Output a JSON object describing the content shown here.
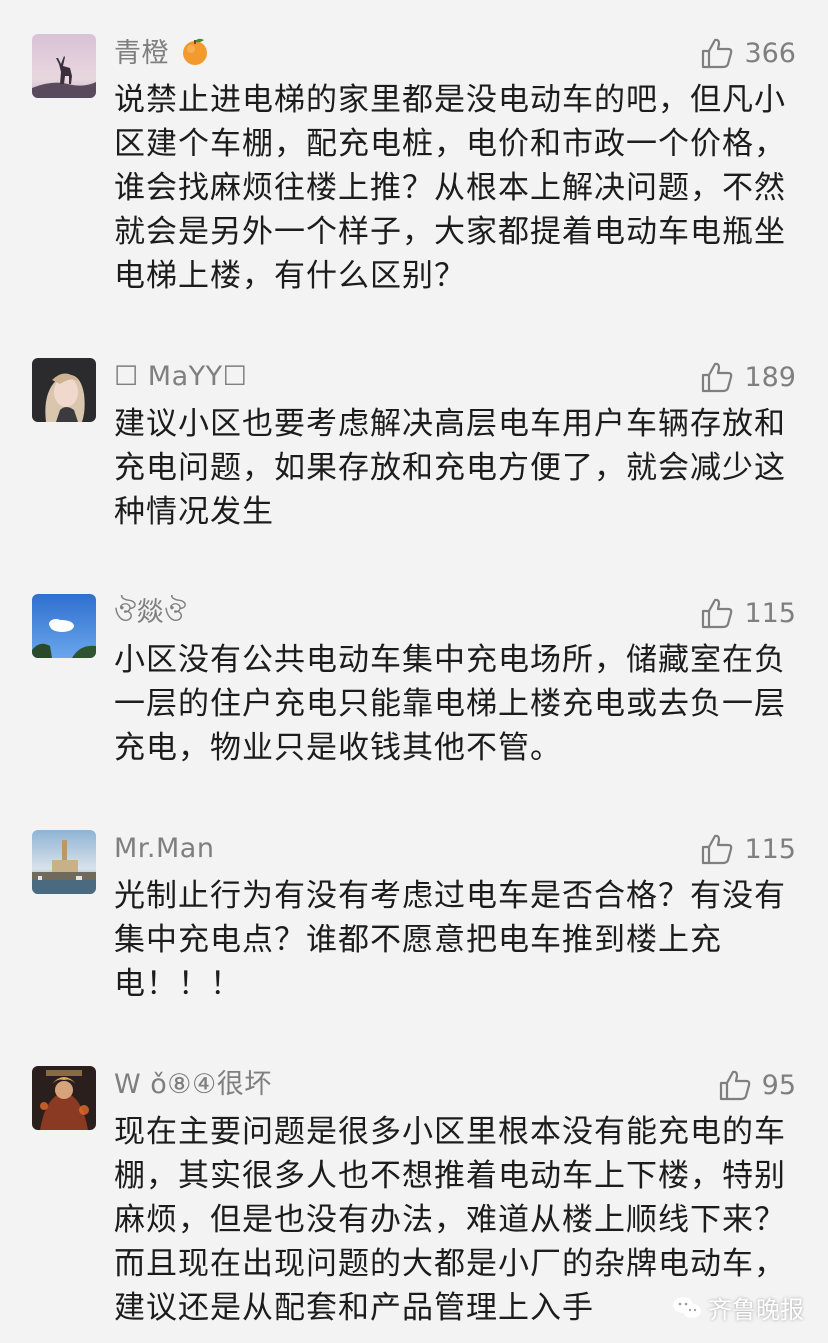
{
  "comments": [
    {
      "username": "青橙",
      "likes": "366",
      "text": "说禁止进电梯的家里都是没电动车的吧，但凡小区建个车棚，配充电桩，电价和市政一个价格，谁会找麻烦往楼上推？从根本上解决问题，不然就会是另外一个样子，大家都提着电动车电瓶坐电梯上楼，有什么区别？"
    },
    {
      "username": "☐ MaYY☐",
      "likes": "189",
      "text": "建议小区也要考虑解决高层电车用户车辆存放和充电问题，如果存放和充电方便了，就会减少这种情况发生"
    },
    {
      "username": "ঔ燚ঔ",
      "likes": "115",
      "text": "小区没有公共电动车集中充电场所，储藏室在负一层的住户充电只能靠电梯上楼充电或去负一层充电，物业只是收钱其他不管。"
    },
    {
      "username": "Mr.Man",
      "likes": "115",
      "text": "光制止行为有没有考虑过电车是否合格？有没有集中充电点？谁都不愿意把电车推到楼上充电！！！"
    },
    {
      "username": "W ǒ⑧④很坏",
      "likes": "95",
      "text": "现在主要问题是很多小区里根本没有能充电的车棚，其实很多人也不想推着电动车上下楼，特别麻烦，但是也没有办法，难道从楼上顺线下来？而且现在出现问题的大都是小厂的杂牌电动车，建议还是从配套和产品管理上入手"
    }
  ],
  "watermark": {
    "text": "齐鲁晚报",
    "icon": "wechat-icon"
  },
  "icons": {
    "like": "thumbs-up-icon",
    "emoji": "tangerine-emoji-icon"
  },
  "colors": {
    "background": "#f3f3f3",
    "meta_gray": "#7f7f7f",
    "text": "#1c1c1c"
  }
}
